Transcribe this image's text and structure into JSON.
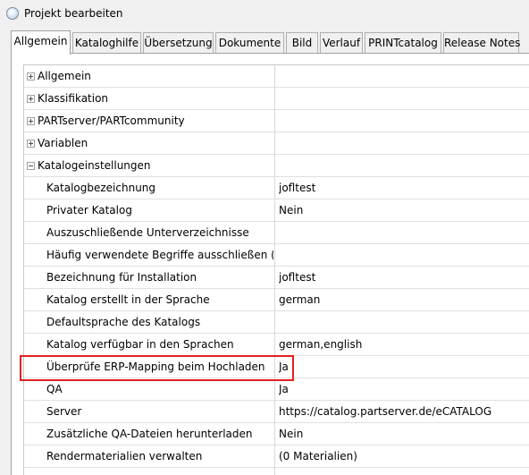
{
  "window": {
    "title": "Projekt bearbeiten"
  },
  "tabs": [
    {
      "label": "Allgemein"
    },
    {
      "label": "Kataloghilfe"
    },
    {
      "label": "Übersetzung"
    },
    {
      "label": "Dokumente"
    },
    {
      "label": "Bild"
    },
    {
      "label": "Verlauf"
    },
    {
      "label": "PRINTcatalog"
    },
    {
      "label": "Release Notes"
    }
  ],
  "active_tab": "Allgemein",
  "groups": [
    {
      "label": "Allgemein",
      "state": "collapsed"
    },
    {
      "label": "Klassifikation",
      "state": "collapsed"
    },
    {
      "label": "PARTserver/PARTcommunity",
      "state": "collapsed"
    },
    {
      "label": "Variablen",
      "state": "collapsed"
    },
    {
      "label": "Katalogeinstellungen",
      "state": "expanded"
    }
  ],
  "properties": [
    {
      "name": "Katalogbezeichnung",
      "value": "jofltest"
    },
    {
      "name": "Privater Katalog",
      "value": "Nein"
    },
    {
      "name": "Auszuschließende Unterverzeichnisse",
      "value": ""
    },
    {
      "name": "Häufig verwendete Begriffe ausschließen (Tag...",
      "value": ""
    },
    {
      "name": "Bezeichnung für Installation",
      "value": "jofltest"
    },
    {
      "name": "Katalog erstellt in der Sprache",
      "value": "german"
    },
    {
      "name": "Defaultsprache des Katalogs",
      "value": ""
    },
    {
      "name": "Katalog verfügbar in den Sprachen",
      "value": "german,english"
    },
    {
      "name": "Überprüfe ERP-Mapping beim Hochladen",
      "value": "Ja"
    },
    {
      "name": "QA",
      "value": "Ja"
    },
    {
      "name": "Server",
      "value": "https://catalog.partserver.de/eCATALOG"
    },
    {
      "name": "Zusätzliche QA-Dateien herunterladen",
      "value": "Nein"
    },
    {
      "name": "Rendermaterialien verwalten",
      "value": "(0 Materialien)"
    }
  ],
  "colors": {
    "highlight": "#e02020"
  }
}
